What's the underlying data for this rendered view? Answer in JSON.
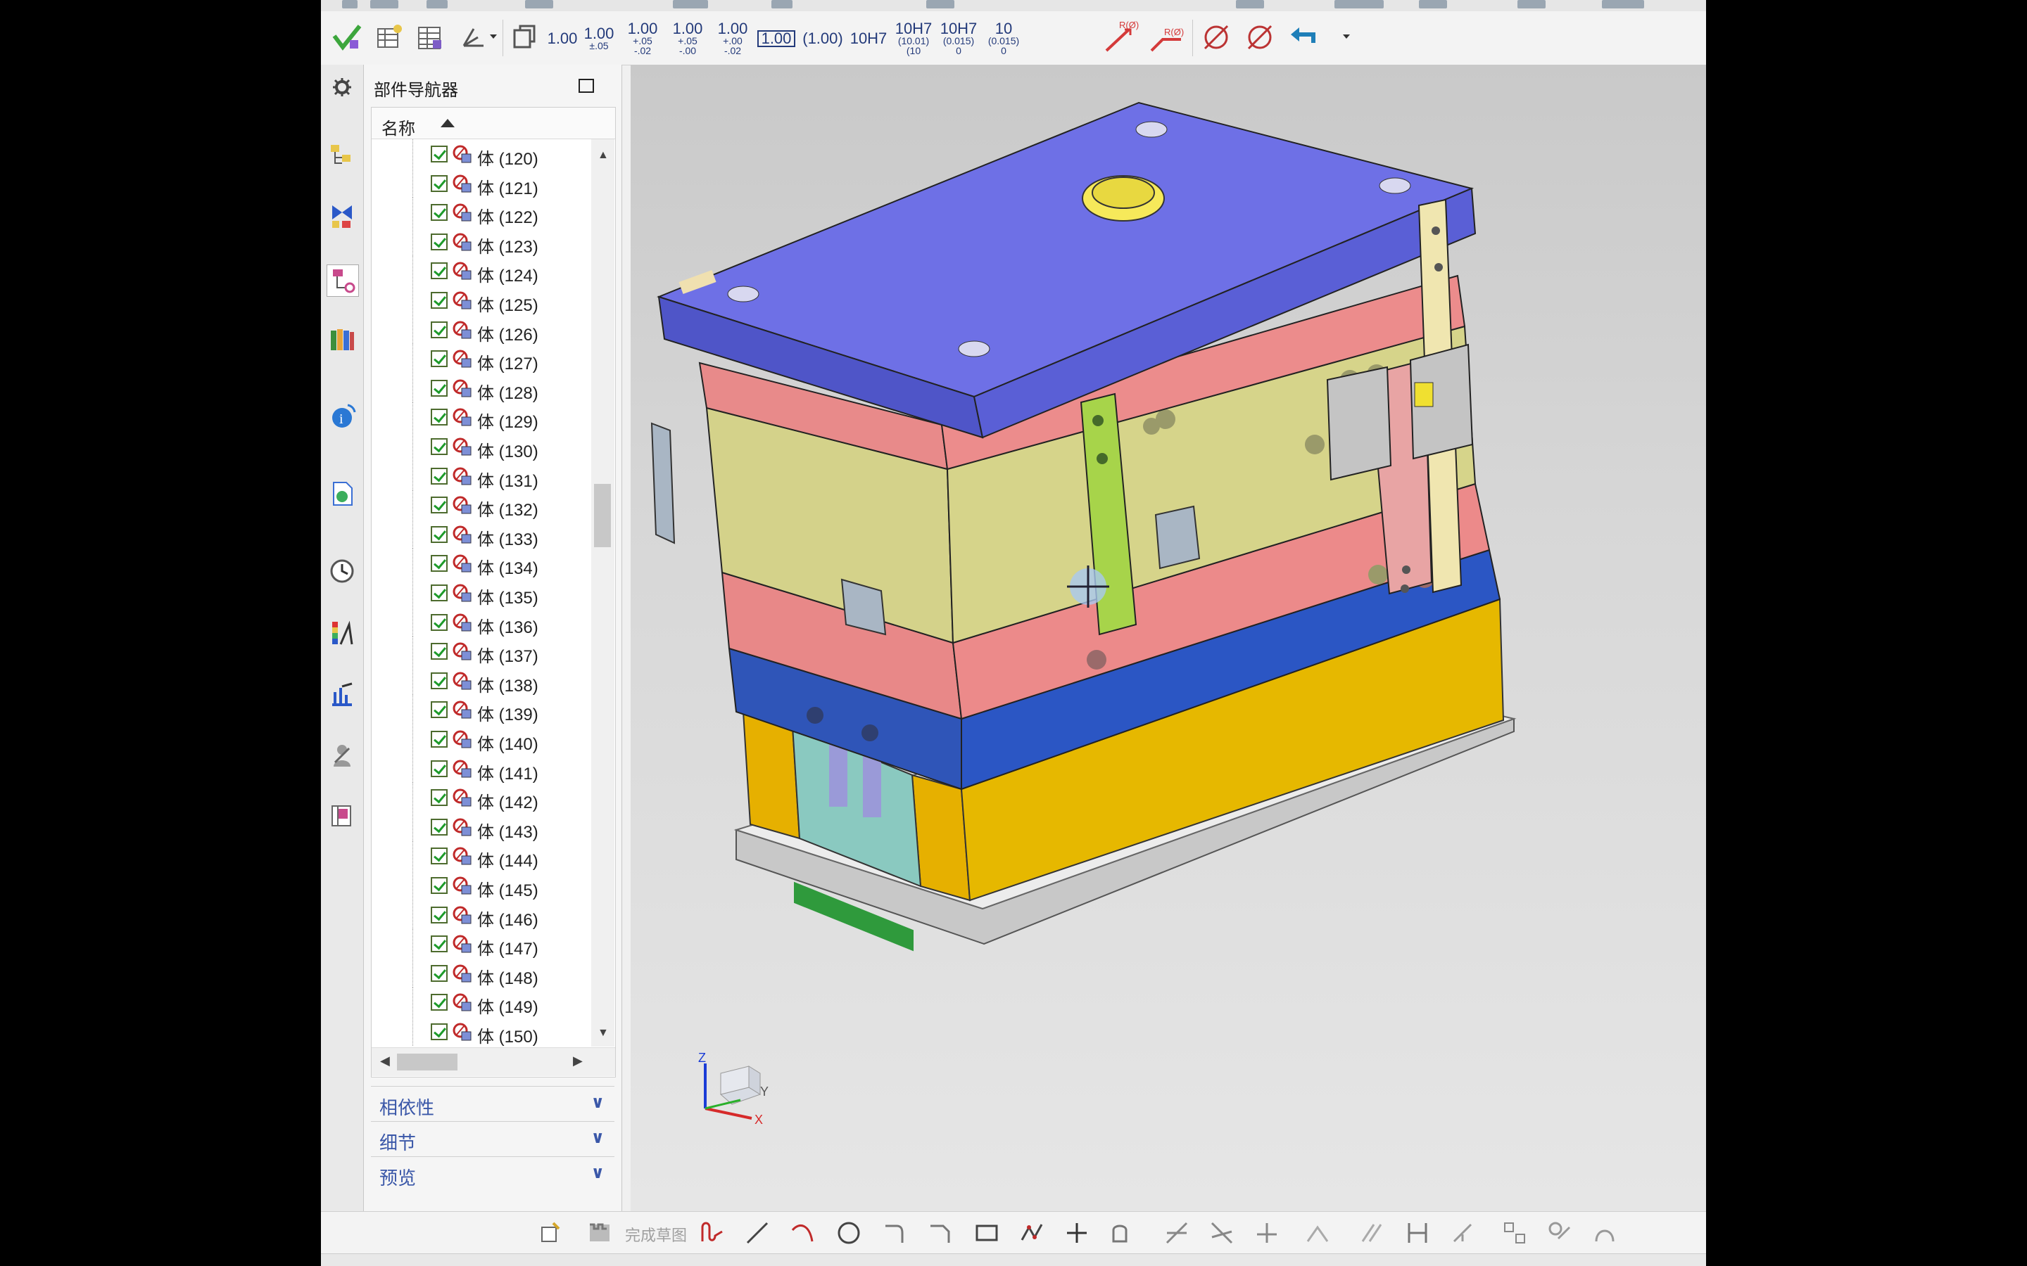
{
  "navigator": {
    "title": "部件导航器",
    "column_header": "名称",
    "rows": [
      {
        "label": "体 (120)"
      },
      {
        "label": "体 (121)"
      },
      {
        "label": "体 (122)"
      },
      {
        "label": "体 (123)"
      },
      {
        "label": "体 (124)"
      },
      {
        "label": "体 (125)"
      },
      {
        "label": "体 (126)"
      },
      {
        "label": "体 (127)"
      },
      {
        "label": "体 (128)"
      },
      {
        "label": "体 (129)"
      },
      {
        "label": "体 (130)"
      },
      {
        "label": "体 (131)"
      },
      {
        "label": "体 (132)"
      },
      {
        "label": "体 (133)"
      },
      {
        "label": "体 (134)"
      },
      {
        "label": "体 (135)"
      },
      {
        "label": "体 (136)"
      },
      {
        "label": "体 (137)"
      },
      {
        "label": "体 (138)"
      },
      {
        "label": "体 (139)"
      },
      {
        "label": "体 (140)"
      },
      {
        "label": "体 (141)"
      },
      {
        "label": "体 (142)"
      },
      {
        "label": "体 (143)"
      },
      {
        "label": "体 (144)"
      },
      {
        "label": "体 (145)"
      },
      {
        "label": "体 (146)"
      },
      {
        "label": "体 (147)"
      },
      {
        "label": "体 (148)"
      },
      {
        "label": "体 (149)"
      },
      {
        "label": "体 (150)"
      }
    ],
    "sections": {
      "dependencies": "相依性",
      "details": "细节",
      "preview": "预览"
    }
  },
  "toolbar": {
    "dim_a": "1.00",
    "dim_b_main": "1.00",
    "dim_b_sub": "±.05",
    "dim_c_main": "1.00",
    "dim_c_sub1": "+.05",
    "dim_c_sub2": "-.02",
    "dim_d_main": "1.00",
    "dim_d_sub1": "+.05",
    "dim_d_sub2": "-.00",
    "dim_e_main": "1.00",
    "dim_e_sub1": "+.00",
    "dim_e_sub2": "-.02",
    "dim_f": "1.00",
    "dim_g": "(1.00)",
    "fit_a": "10H7",
    "fit_b_main": "10H7",
    "fit_b_sub1": "(10.01)",
    "fit_b_sub2": "(10",
    "fit_c_main": "10H7",
    "fit_c_sub1": "(0.015)",
    "fit_c_sub2": "0",
    "fit_d_main": "10",
    "fit_d_sub1": "(0.015)",
    "fit_d_sub2": "0",
    "radius_a": "R(Ø)",
    "radius_b": "R(Ø)"
  },
  "bottom_toolbar": {
    "finish_sketch": "完成草图"
  },
  "triad": {
    "z": "Z",
    "y": "Y",
    "x": "X"
  },
  "colors": {
    "top_plate": "#6b6fe0",
    "pink_plate": "#e88a8a",
    "cavity": "#d6d38a",
    "blue_plate": "#2f5fc0",
    "support": "#e6b800",
    "base": "#d4d4d4",
    "accent": "#233a7a"
  }
}
